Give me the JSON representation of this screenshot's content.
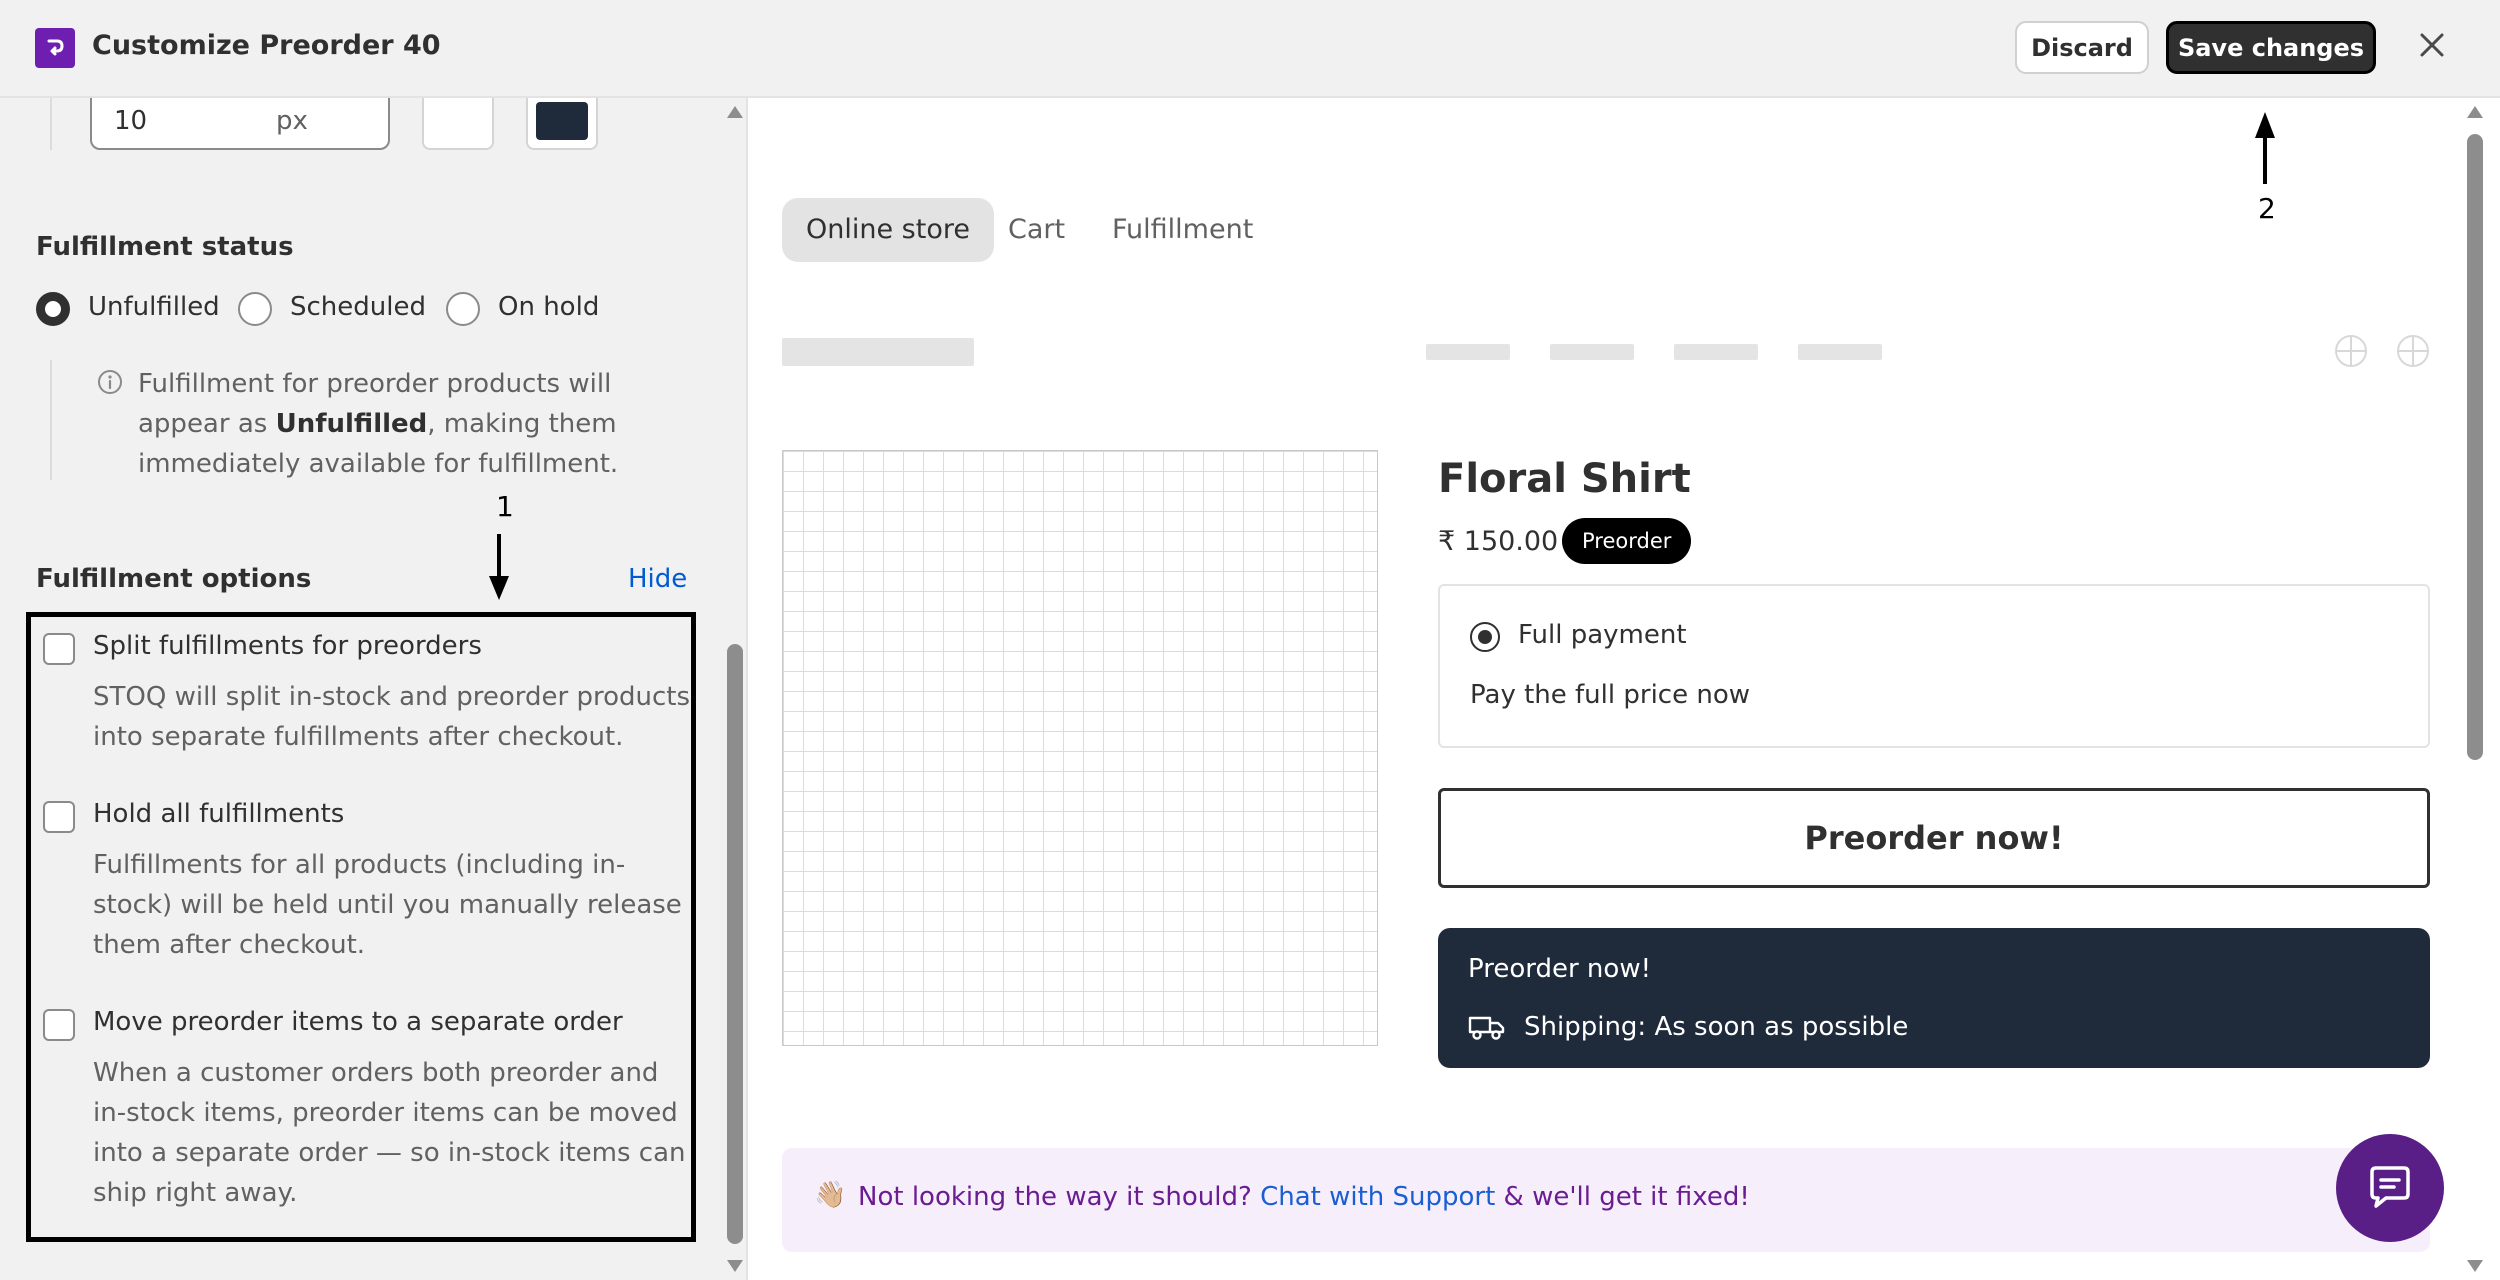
{
  "header": {
    "title": "Customize Preorder 40",
    "discard_label": "Discard",
    "save_label": "Save changes"
  },
  "left": {
    "px_value": "10",
    "px_unit": "px",
    "swatch_color": "#1f2a3b",
    "fulfillment_status": {
      "title": "Fulfillment status",
      "options": [
        "Unfulfilled",
        "Scheduled",
        "On hold"
      ],
      "selected": "Unfulfilled",
      "info_prefix": "Fulfillment for preorder products will appear as ",
      "info_bold": "Unfulfilled",
      "info_suffix": ", making them immediately available for fulfillment."
    },
    "fulfillment_options": {
      "title": "Fulfillment options",
      "hide_label": "Hide",
      "items": [
        {
          "title": "Split fulfillments for preorders",
          "desc": "STOQ will split in-stock and preorder products into separate fulfillments after checkout.",
          "checked": false
        },
        {
          "title": "Hold all fulfillments",
          "desc": "Fulfillments for all products (including in-stock) will be held until you manually release them after checkout.",
          "checked": false
        },
        {
          "title": "Move preorder items to a separate order",
          "desc": "When a customer orders both preorder and in-stock items, preorder items can be moved into a separate order — so in-stock items can ship right away.",
          "checked": false
        }
      ]
    }
  },
  "annotations": {
    "a1": "1",
    "a2": "2"
  },
  "preview": {
    "tabs": [
      "Online store",
      "Cart",
      "Fulfillment"
    ],
    "active_tab": "Online store",
    "product": {
      "title": "Floral Shirt",
      "price": "₹ 150.00",
      "badge": "Preorder",
      "payment_label": "Full payment",
      "payment_desc": "Pay the full price now",
      "button_label": "Preorder now!",
      "card_title": "Preorder now!",
      "shipping": "Shipping: As soon as possible"
    },
    "support": {
      "wave": "👋🏼",
      "prefix": "Not looking the way it should? ",
      "link": "Chat with Support",
      "suffix": " & we'll get it fixed!"
    }
  },
  "colors": {
    "accent": "#6f1fb0",
    "link": "#005bd3",
    "dark_card": "#1f2a3b"
  }
}
